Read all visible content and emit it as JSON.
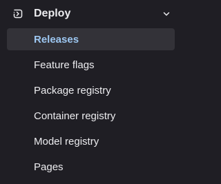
{
  "section": {
    "title": "Deploy",
    "icon": "deploy-icon",
    "expanded_icon": "chevron-down-icon"
  },
  "items": [
    {
      "label": "Releases",
      "active": true
    },
    {
      "label": "Feature flags",
      "active": false
    },
    {
      "label": "Package registry",
      "active": false
    },
    {
      "label": "Container registry",
      "active": false
    },
    {
      "label": "Model registry",
      "active": false
    },
    {
      "label": "Pages",
      "active": false
    }
  ],
  "colors": {
    "background": "#1f1e24",
    "text": "#ececef",
    "active_background": "#333238",
    "active_text": "#9dc7f1"
  }
}
